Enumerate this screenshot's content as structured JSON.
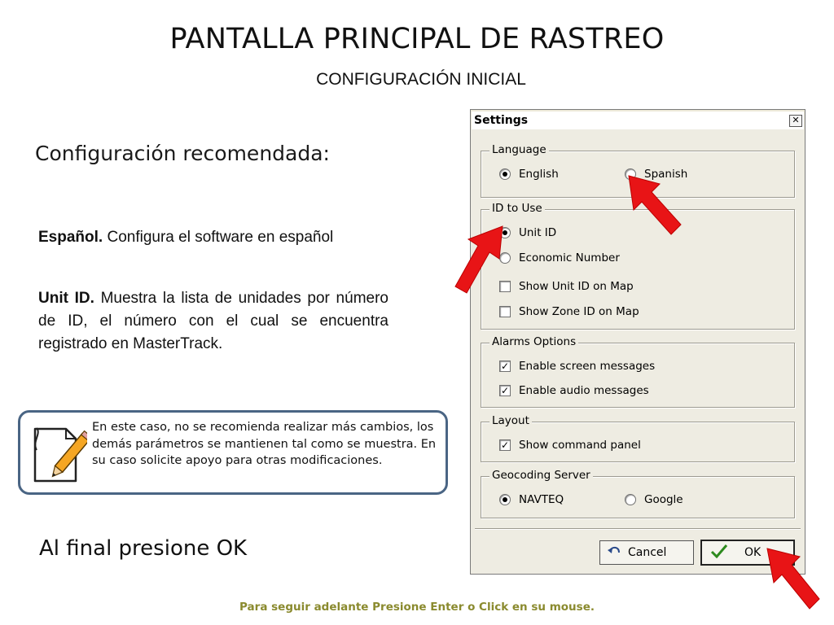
{
  "slide": {
    "title": "PANTALLA PRINCIPAL DE RASTREO",
    "subtitle": "CONFIGURACIÓN INICIAL",
    "heading": "Configuración recomendada:",
    "para1_bold": "Español.",
    "para1_text": " Configura el software en español",
    "para2_bold": "Unit ID.",
    "para2_text": " Muestra la lista de unidades por número de ID, el número con el cual se encuentra registrado en MasterTrack.",
    "note_text": "En este caso, no se recomienda realizar más cambios, los demás parámetros se mantienen tal como se muestra. En su caso solicite apoyo para otras modificaciones.",
    "final_text": "Al final presione OK",
    "footer": "Para seguir adelante Presione Enter o Click en su mouse."
  },
  "dialog": {
    "title": "Settings",
    "close_symbol": "✕",
    "language": {
      "label": "Language",
      "options": [
        "English",
        "Spanish"
      ],
      "selected": "English"
    },
    "id_to_use": {
      "label": "ID to Use",
      "radio_options": [
        "Unit ID",
        "Economic Number"
      ],
      "selected": "Unit ID",
      "checkboxes": [
        {
          "label": "Show Unit ID on Map",
          "checked": false
        },
        {
          "label": "Show Zone ID on Map",
          "checked": false
        }
      ]
    },
    "alarms": {
      "label": "Alarms Options",
      "checkboxes": [
        {
          "label": "Enable screen messages",
          "checked": true
        },
        {
          "label": "Enable audio messages",
          "checked": true
        }
      ]
    },
    "layout": {
      "label": "Layout",
      "checkboxes": [
        {
          "label": "Show command panel",
          "checked": true
        }
      ]
    },
    "geocoding": {
      "label": "Geocoding Server",
      "options": [
        "NAVTEQ",
        "Google"
      ],
      "selected": "NAVTEQ"
    },
    "buttons": {
      "cancel": "Cancel",
      "ok": "OK"
    },
    "check_mark": "✓"
  },
  "colors": {
    "note_border": "#4a6584",
    "arrow_red": "#e81416",
    "footer_text": "#8a8a2e",
    "dialog_bg": "#eeece2"
  }
}
